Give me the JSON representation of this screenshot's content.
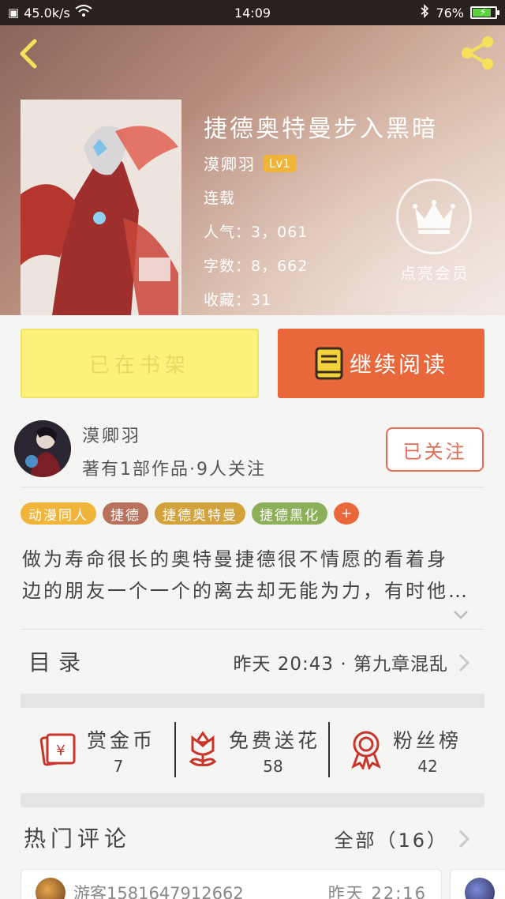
{
  "status_bar": {
    "speed": "45.0k/s",
    "time": "14:09",
    "battery": "76%",
    "icons": [
      "notification-icon",
      "wifi-icon",
      "bluetooth-icon",
      "battery-charging-icon"
    ]
  },
  "header": {
    "icons": {
      "back": "back-chevron-icon",
      "share": "share-icon",
      "vip": "crown-icon"
    },
    "title": "捷德奥特曼步入黑暗",
    "author": "漠卿羽",
    "level": "Lv1",
    "status": "连载",
    "popularity": "人气：3，061",
    "word_count": "字数：8，662",
    "favorites": "收藏：31",
    "vip_label": "点亮会员"
  },
  "actions": {
    "shelf_label": "已在书架",
    "read_label": "继续阅读",
    "read_icon": "book-icon"
  },
  "author_block": {
    "name": "漠卿羽",
    "stats": "著有1部作品·9人关注",
    "follow_label": "已关注"
  },
  "tags": [
    {
      "label": "动漫同人",
      "color": "#f0b43a"
    },
    {
      "label": "捷德",
      "color": "#b8715c"
    },
    {
      "label": "捷德奥特曼",
      "color": "#d4a23c"
    },
    {
      "label": "捷德黑化",
      "color": "#8cb05a"
    },
    {
      "label": "+",
      "color": "#e8683c"
    }
  ],
  "description": {
    "line1": "做为寿命很长的奥特曼捷德很不情愿的看着身",
    "line2": "边的朋友一个一个的离去却无能为力，有时他…"
  },
  "catalog": {
    "label": "目录",
    "latest": "昨天 20:43 · 第九章混乱"
  },
  "stats": [
    {
      "label": "赏金币",
      "count": "7",
      "icon": "red-envelope-icon"
    },
    {
      "label": "免费送花",
      "count": "58",
      "icon": "flower-icon"
    },
    {
      "label": "粉丝榜",
      "count": "42",
      "icon": "medal-icon"
    }
  ],
  "comments": {
    "title": "热门评论",
    "all_label": "全部（16）",
    "items": [
      {
        "user": "游客1581647912662",
        "time": "昨天 22:16"
      }
    ]
  },
  "colors": {
    "accent": "#e8683c",
    "shelf_bg": "#fbf27e",
    "follow": "#e56b55"
  }
}
